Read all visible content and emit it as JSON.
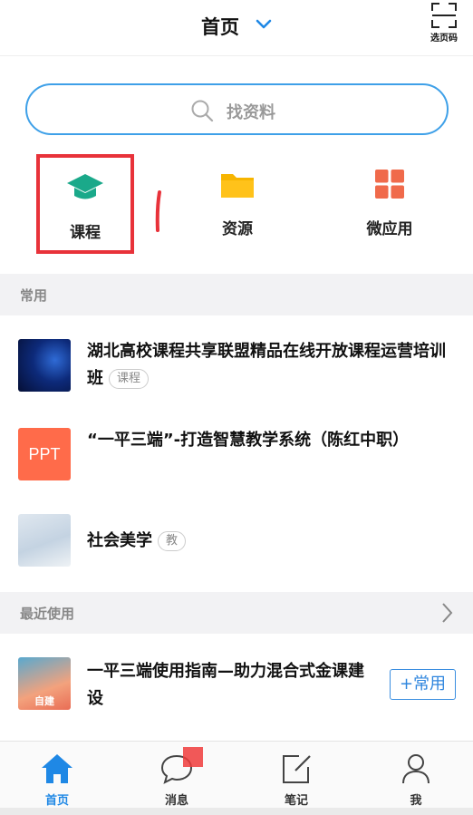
{
  "header": {
    "title": "首页",
    "scan_label": "选页码"
  },
  "search": {
    "placeholder": "找资料"
  },
  "quick_entries": [
    {
      "label": "课程"
    },
    {
      "label": "资源"
    },
    {
      "label": "微应用"
    }
  ],
  "sections": {
    "common": {
      "title": "常用"
    },
    "recent": {
      "title": "最近使用"
    }
  },
  "common_items": [
    {
      "title": "湖北高校课程共享联盟精品在线开放课程运营培训班",
      "tag": "课程"
    },
    {
      "title": "“一平三端”-打造智慧教学系统（陈红中职）",
      "thumb_text": "PPT"
    },
    {
      "title": "社会美学",
      "tag": "教"
    }
  ],
  "recent_items": [
    {
      "title": "一平三端使用指南—助力混合式金课建设",
      "thumb_text": "自建",
      "action_label": "+常用"
    }
  ],
  "tabbar": [
    {
      "label": "首页",
      "active": true
    },
    {
      "label": "消息"
    },
    {
      "label": "笔记"
    },
    {
      "label": "我"
    }
  ],
  "colors": {
    "accent": "#1f88e5",
    "highlight_box": "#e8323a",
    "course_icon": "#1aa98a",
    "folder_icon": "#f7b500",
    "app_icon": "#f06a4b"
  }
}
